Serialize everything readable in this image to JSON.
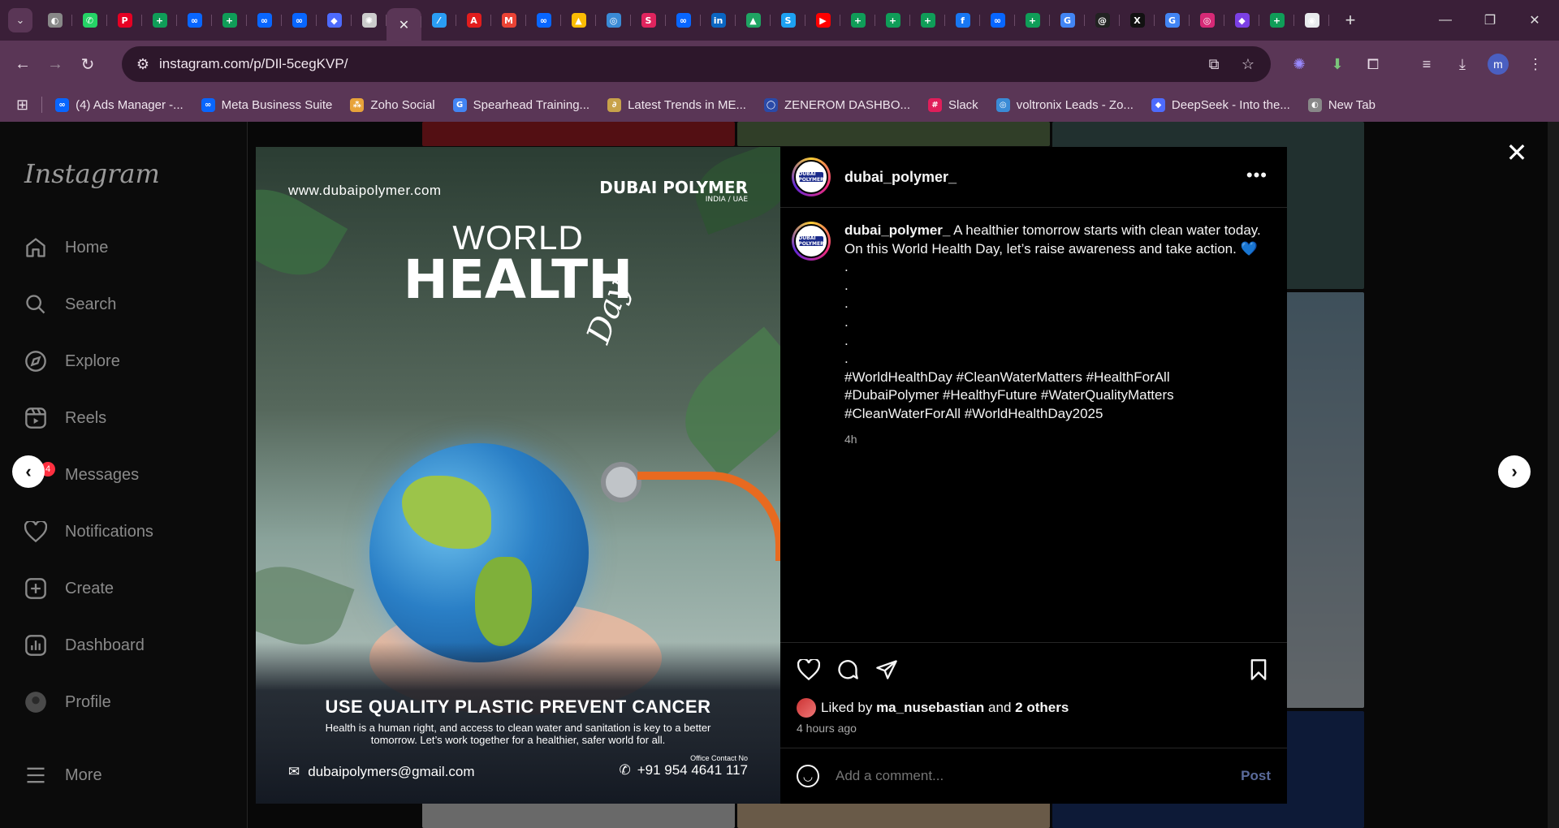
{
  "browser": {
    "tab_menu_icon": "chevron-down-icon",
    "tabs": [
      {
        "icon": "globe-icon",
        "color": "#888888",
        "glyph": "◐"
      },
      {
        "icon": "whatsapp-icon",
        "color": "#25d366",
        "glyph": "✆"
      },
      {
        "icon": "pinterest-icon",
        "color": "#e60023",
        "glyph": "P"
      },
      {
        "icon": "sheets-icon",
        "color": "#0f9d58",
        "glyph": "+"
      },
      {
        "icon": "meta-icon",
        "color": "#0866ff",
        "glyph": "∞"
      },
      {
        "icon": "sheets-icon",
        "color": "#0f9d58",
        "glyph": "+"
      },
      {
        "icon": "meta-icon",
        "color": "#0866ff",
        "glyph": "∞"
      },
      {
        "icon": "meta-icon",
        "color": "#0866ff",
        "glyph": "∞"
      },
      {
        "icon": "deepseek-icon",
        "color": "#4d6bfe",
        "glyph": "◆"
      },
      {
        "icon": "openai-icon",
        "color": "#cccccc",
        "glyph": "✺"
      },
      {
        "icon": "close-tab-icon",
        "color": "#5a3656",
        "glyph": "✕",
        "active": true
      },
      {
        "icon": "feather-icon",
        "color": "#2a9df4",
        "glyph": "⁄"
      },
      {
        "icon": "adobe-icon",
        "color": "#e21d1d",
        "glyph": "A"
      },
      {
        "icon": "gmail-icon",
        "color": "#ea4335",
        "glyph": "M"
      },
      {
        "icon": "meta-icon",
        "color": "#0866ff",
        "glyph": "∞"
      },
      {
        "icon": "google-ads-icon",
        "color": "#fbbc04",
        "glyph": "▲"
      },
      {
        "icon": "voltronix-icon",
        "color": "#3a8bd6",
        "glyph": "◎"
      },
      {
        "icon": "app-icon",
        "color": "#e0245e",
        "glyph": "S"
      },
      {
        "icon": "meta-icon",
        "color": "#0866ff",
        "glyph": "∞"
      },
      {
        "icon": "linkedin-icon",
        "color": "#0a66c2",
        "glyph": "in"
      },
      {
        "icon": "drive-icon",
        "color": "#1fa463",
        "glyph": "▲"
      },
      {
        "icon": "app-icon",
        "color": "#1da1f2",
        "glyph": "S"
      },
      {
        "icon": "youtube-icon",
        "color": "#ff0000",
        "glyph": "▶"
      },
      {
        "icon": "sheets-icon",
        "color": "#0f9d58",
        "glyph": "+"
      },
      {
        "icon": "sheets-icon",
        "color": "#0f9d58",
        "glyph": "+"
      },
      {
        "icon": "sheets-icon",
        "color": "#0f9d58",
        "glyph": "+"
      },
      {
        "icon": "facebook-icon",
        "color": "#1877f2",
        "glyph": "f"
      },
      {
        "icon": "meta-icon",
        "color": "#0866ff",
        "glyph": "∞"
      },
      {
        "icon": "sheets-icon",
        "color": "#0f9d58",
        "glyph": "+"
      },
      {
        "icon": "google-icon",
        "color": "#4285f4",
        "glyph": "G"
      },
      {
        "icon": "threads-icon",
        "color": "#222222",
        "glyph": "@"
      },
      {
        "icon": "x-icon",
        "color": "#111111",
        "glyph": "X"
      },
      {
        "icon": "google-icon",
        "color": "#4285f4",
        "glyph": "G"
      },
      {
        "icon": "instagram-icon",
        "color": "#d62976",
        "glyph": "◎"
      },
      {
        "icon": "app-icon",
        "color": "#7b3fe4",
        "glyph": "◆"
      },
      {
        "icon": "sheets-icon",
        "color": "#0f9d58",
        "glyph": "+"
      },
      {
        "icon": "gemini-icon",
        "color": "#e8eaed",
        "glyph": "◉"
      }
    ],
    "new_tab": "+",
    "url": "instagram.com/p/DIl-5cegKVP/",
    "bookmarks": [
      {
        "label": "(4) Ads Manager -...",
        "icon": "meta-icon",
        "color": "#0866ff",
        "glyph": "∞"
      },
      {
        "label": "Meta Business Suite",
        "icon": "meta-icon",
        "color": "#0866ff",
        "glyph": "∞"
      },
      {
        "label": "Zoho Social",
        "icon": "zoho-icon",
        "color": "#e8a33a",
        "glyph": "⁂"
      },
      {
        "label": "Spearhead Training...",
        "icon": "google-icon",
        "color": "#4285f4",
        "glyph": "G"
      },
      {
        "label": "Latest Trends in ME...",
        "icon": "link-icon",
        "color": "#c8a24a",
        "glyph": "∂"
      },
      {
        "label": "ZENEROM DASHBO...",
        "icon": "zenerom-icon",
        "color": "#2a4aa8",
        "glyph": "◯"
      },
      {
        "label": "Slack",
        "icon": "slack-icon",
        "color": "#e01e5a",
        "glyph": "#"
      },
      {
        "label": "voltronix Leads - Zo...",
        "icon": "voltronix-icon",
        "color": "#3a8bd6",
        "glyph": "◎"
      },
      {
        "label": "DeepSeek - Into the...",
        "icon": "deepseek-icon",
        "color": "#4d6bfe",
        "glyph": "◆"
      },
      {
        "label": "New Tab",
        "icon": "globe-icon",
        "color": "#888888",
        "glyph": "◐"
      }
    ],
    "profile_initial": "m"
  },
  "sidebar": {
    "logo": "Instagram",
    "items": [
      {
        "label": "Home",
        "icon": "home-icon"
      },
      {
        "label": "Search",
        "icon": "search-icon"
      },
      {
        "label": "Explore",
        "icon": "compass-icon"
      },
      {
        "label": "Reels",
        "icon": "reels-icon"
      },
      {
        "label": "Messages",
        "icon": "messenger-icon"
      },
      {
        "label": "Notifications",
        "icon": "heart-icon"
      },
      {
        "label": "Create",
        "icon": "plus-square-icon"
      },
      {
        "label": "Dashboard",
        "icon": "chart-icon"
      },
      {
        "label": "Profile",
        "icon": "avatar-icon"
      },
      {
        "label": "More",
        "icon": "hamburger-icon"
      }
    ],
    "messages_badge": "4"
  },
  "post": {
    "username": "dubai_polymer_",
    "avatar_text": "DUBAI POLYMER",
    "caption_lines": [
      "A healthier tomorrow starts with clean water today. On this World Health Day, let’s raise awareness and take action. 💙",
      ".",
      ".",
      ".",
      ".",
      ".",
      ".",
      "#WorldHealthDay #CleanWaterMatters #HealthForAll #DubaiPolymer #HealthyFuture #WaterQualityMatters #CleanWaterForAll #WorldHealthDay2025"
    ],
    "caption_time": "4h",
    "liked_by_prefix": "Liked by",
    "liked_by_user": "ma_nusebastian",
    "liked_by_and": "and",
    "liked_by_others": "2 others",
    "posted_ago": "4 hours ago",
    "comment_placeholder": "Add a comment...",
    "post_label": "Post"
  },
  "poster": {
    "url": "www.dubaipolymer.com",
    "brand": "DUBAI POLYMER",
    "brand_sub": "INDIA / UAE",
    "world": "WORLD",
    "health": "HEALTH",
    "day": "Day",
    "slogan": "USE QUALITY PLASTIC PREVENT CANCER",
    "sub": "Health is a human right, and access to clean water and sanitation is key to a better tomorrow. Let’s work together for a healthier, safer world for all.",
    "email": "dubaipolymers@gmail.com",
    "contact_label": "Office Contact No",
    "phone": "+91 954 4641 117"
  }
}
